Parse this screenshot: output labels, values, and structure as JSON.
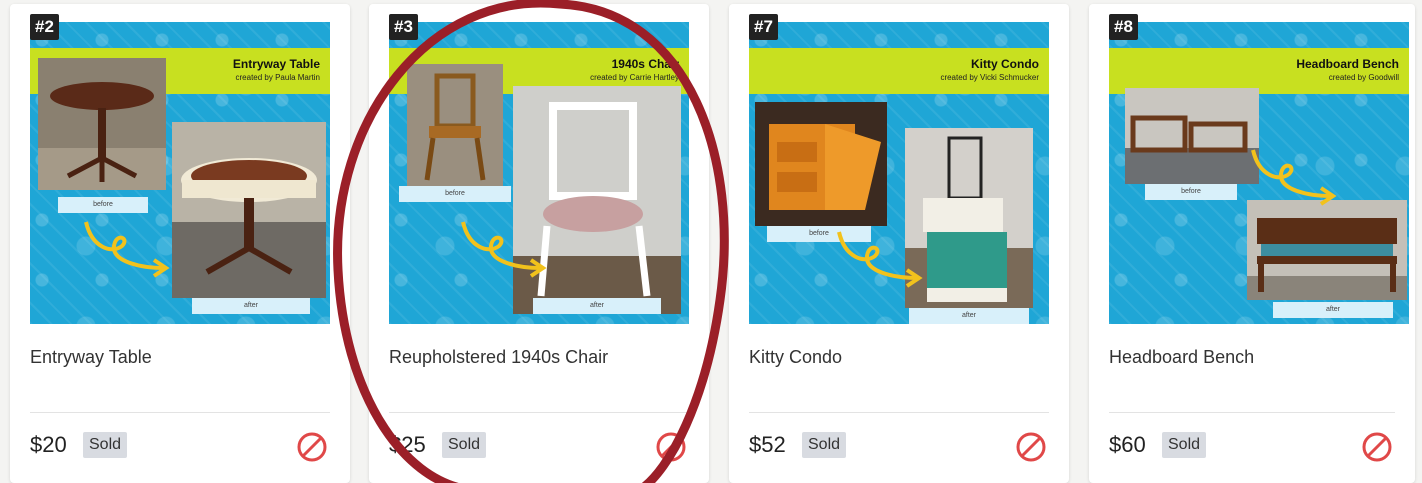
{
  "colors": {
    "poster_bg": "#1fa6d6",
    "banner": "#c8e020",
    "no_sign": "#e04848",
    "circle": "#9b1f28"
  },
  "cards": [
    {
      "badge": "#2",
      "poster_title": "Entryway Table",
      "poster_credit": "created by Paula Martin",
      "before_label": "before",
      "after_label": "after",
      "title": "Entryway Table",
      "price": "$20",
      "status": "Sold"
    },
    {
      "badge": "#3",
      "poster_title": "1940s Chair",
      "poster_credit": "created by Carrie Hartley",
      "before_label": "before",
      "after_label": "after",
      "title": "Reupholstered 1940s Chair",
      "price": "$25",
      "status": "Sold"
    },
    {
      "badge": "#7",
      "poster_title": "Kitty Condo",
      "poster_credit": "created by Vicki Schmucker",
      "before_label": "before",
      "after_label": "after",
      "title": "Kitty Condo",
      "price": "$52",
      "status": "Sold"
    },
    {
      "badge": "#8",
      "poster_title": "Headboard Bench",
      "poster_credit": "created by Goodwill",
      "before_label": "before",
      "after_label": "after",
      "title": "Headboard Bench",
      "price": "$60",
      "status": "Sold"
    }
  ],
  "icons": {
    "unavailable": "no-entry-icon",
    "transform": "curly-arrow-icon"
  }
}
